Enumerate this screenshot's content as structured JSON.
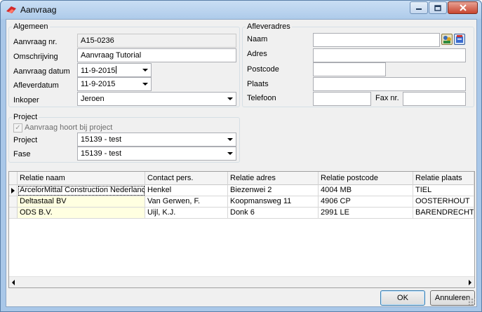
{
  "window": {
    "title": "Aanvraag",
    "minimize": "0",
    "maximize": "1",
    "close": "r"
  },
  "algemeen": {
    "title": "Algemeen",
    "aanvraag_nr_label": "Aanvraag nr.",
    "aanvraag_nr_value": "A15-0236",
    "omschrijving_label": "Omschrijving",
    "omschrijving_value": "Aanvraag Tutorial",
    "aanvraag_datum_label": "Aanvraag datum",
    "aanvraag_datum_value": "11-9-2015",
    "afleverdatum_label": "Afleverdatum",
    "afleverdatum_value": "11-9-2015",
    "inkoper_label": "Inkoper",
    "inkoper_value": "Jeroen"
  },
  "afleveradres": {
    "title": "Afleveradres",
    "naam_label": "Naam",
    "naam_value": "",
    "adres_label": "Adres",
    "adres_value": "",
    "postcode_label": "Postcode",
    "postcode_value": "",
    "plaats_label": "Plaats",
    "plaats_value": "",
    "telefoon_label": "Telefoon",
    "telefoon_value": "",
    "fax_label": "Fax nr.",
    "fax_value": ""
  },
  "project": {
    "title": "Project",
    "checkbox_label": "Aanvraag hoort bij project",
    "checkbox_checked": true,
    "project_label": "Project",
    "project_value": "15139 - test",
    "fase_label": "Fase",
    "fase_value": "15139 - test"
  },
  "grid": {
    "columns": [
      "Relatie naam",
      "Contact pers.",
      "Relatie adres",
      "Relatie postcode",
      "Relatie plaats"
    ],
    "rows": [
      {
        "naam": "ArcelorMittal Construction Nederland",
        "contact": "Henkel",
        "adres": "Biezenwei 2",
        "postcode": "4004 MB",
        "plaats": "TIEL"
      },
      {
        "naam": "Deltastaal BV",
        "contact": "Van Gerwen, F.",
        "adres": "Koopmansweg 11",
        "postcode": "4906 CP",
        "plaats": "OOSTERHOUT"
      },
      {
        "naam": "ODS B.V.",
        "contact": "Uijl, K.J.",
        "adres": "Donk 6",
        "postcode": "2991 LE",
        "plaats": "BARENDRECHT"
      }
    ]
  },
  "buttons": {
    "ok": "OK",
    "annuleren": "Annuleren"
  },
  "colors": {
    "window_frame": "#a9c7e8",
    "dialog_bg": "#f0f0f0",
    "highlight_cell": "#ffffe1"
  }
}
